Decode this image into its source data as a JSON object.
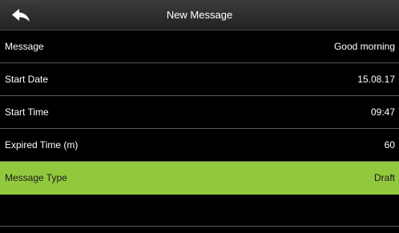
{
  "header": {
    "title": "New Message",
    "back_icon": "back-arrow-icon"
  },
  "rows": [
    {
      "label": "Message",
      "value": "Good morning",
      "selected": false
    },
    {
      "label": "Start Date",
      "value": "15.08.17",
      "selected": false
    },
    {
      "label": "Start Time",
      "value": "09:47",
      "selected": false
    },
    {
      "label": "Expired Time (m)",
      "value": "60",
      "selected": false
    },
    {
      "label": "Message Type",
      "value": "Draft",
      "selected": true
    }
  ],
  "colors": {
    "background": "#000000",
    "highlight": "#92c83e",
    "text": "#ffffff",
    "divider": "#5a5a5a"
  }
}
